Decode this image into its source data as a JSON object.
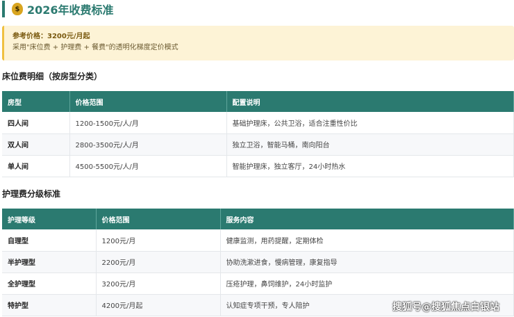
{
  "title": "2026年收费标准",
  "note": {
    "line1": "参考价格：3200元/月起",
    "line2": "采用\"床位费 + 护理费 + 餐费\"的透明化梯度定价模式"
  },
  "bed": {
    "heading": "床位费明细（按房型分类）",
    "headers": [
      "房型",
      "价格范围",
      "配置说明"
    ],
    "rows": [
      [
        "四人间",
        "1200-1500元/人/月",
        "基础护理床，公共卫浴，适合注重性价比"
      ],
      [
        "双人间",
        "2800-3500元/人/月",
        "独立卫浴，智能马桶，南向阳台"
      ],
      [
        "单人间",
        "4500-5500元/人/月",
        "智能护理床，独立客厅，24小时热水"
      ]
    ]
  },
  "care": {
    "heading": "护理费分级标准",
    "headers": [
      "护理等级",
      "价格范围",
      "服务内容"
    ],
    "rows": [
      [
        "自理型",
        "1200元/月",
        "健康监测，用药提醒，定期体检"
      ],
      [
        "半护理型",
        "2200元/月",
        "协助洗漱进食，慢病管理，康复指导"
      ],
      [
        "全护理型",
        "3200元/月",
        "压疮护理，鼻饲维护，24小时监护"
      ],
      [
        "特护型",
        "4200元/月起",
        "认知症专项干预，专人陪护"
      ]
    ]
  },
  "watermark": "搜狐号@搜狐焦点白银站"
}
